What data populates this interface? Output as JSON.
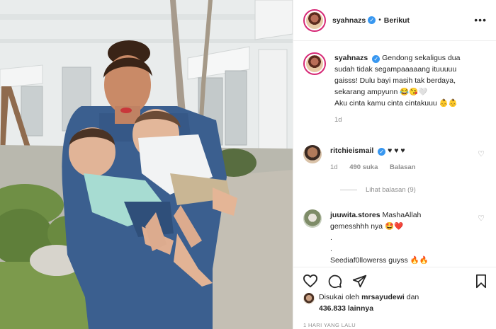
{
  "post": {
    "username": "syahnazs",
    "follow_label": "Berikut",
    "caption_lines": [
      "Gendong sekaligus dua",
      "sudah tidak segampaaaaang ituuuuu",
      "gaisss! Dulu bayi masih tak berdaya,",
      "sekarang ampyunn 😂😘🤍",
      "Aku cinta kamu cinta cintakuuu 👶👶"
    ],
    "caption_time": "1d"
  },
  "comments": [
    {
      "username": "ritchieismail",
      "text": "♥ ♥ ♥",
      "time": "1d",
      "likes": "490 suka",
      "reply_label": "Balasan",
      "view_replies": "Lihat balasan (9)"
    },
    {
      "username": "juuwita.stores",
      "lines": [
        "MashaAllah",
        "gemesshhh nya 🤩❤️",
        ".",
        ".",
        "Seediaf0llowerss guyss 🔥🔥"
      ]
    }
  ],
  "likes": {
    "prefix": "Disukai oleh",
    "user": "mrsayudewi",
    "conj": "dan",
    "count": "436.833 lainnya"
  },
  "posted_ago": "1 HARI YANG LALU",
  "colors": {
    "verified": "#3897f0",
    "ring": "#d62976",
    "muted": "#8e8e8e"
  }
}
